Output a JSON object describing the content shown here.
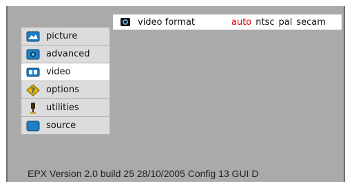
{
  "menu": {
    "items": [
      {
        "label": "picture",
        "icon": "picture-icon"
      },
      {
        "label": "advanced",
        "icon": "advanced-icon"
      },
      {
        "label": "video",
        "icon": "video-icon",
        "selected": true
      },
      {
        "label": "options",
        "icon": "options-icon"
      },
      {
        "label": "utilities",
        "icon": "utilities-icon"
      },
      {
        "label": "source",
        "icon": "source-icon"
      }
    ]
  },
  "submenu": {
    "label": "video format",
    "icon": "video-format-icon",
    "options": [
      "auto",
      "ntsc",
      "pal",
      "secam"
    ],
    "selected_option": "auto"
  },
  "status": {
    "text": "EPX Version 2.0 build 25   28/10/2005  Config 13   GUI D"
  },
  "colors": {
    "panel_bg": "#aaaaaa",
    "item_bg": "#dcdcdc",
    "selected_bg": "#ffffff",
    "active_option": "#e60000",
    "icon_blue": "#1d7fc7"
  }
}
